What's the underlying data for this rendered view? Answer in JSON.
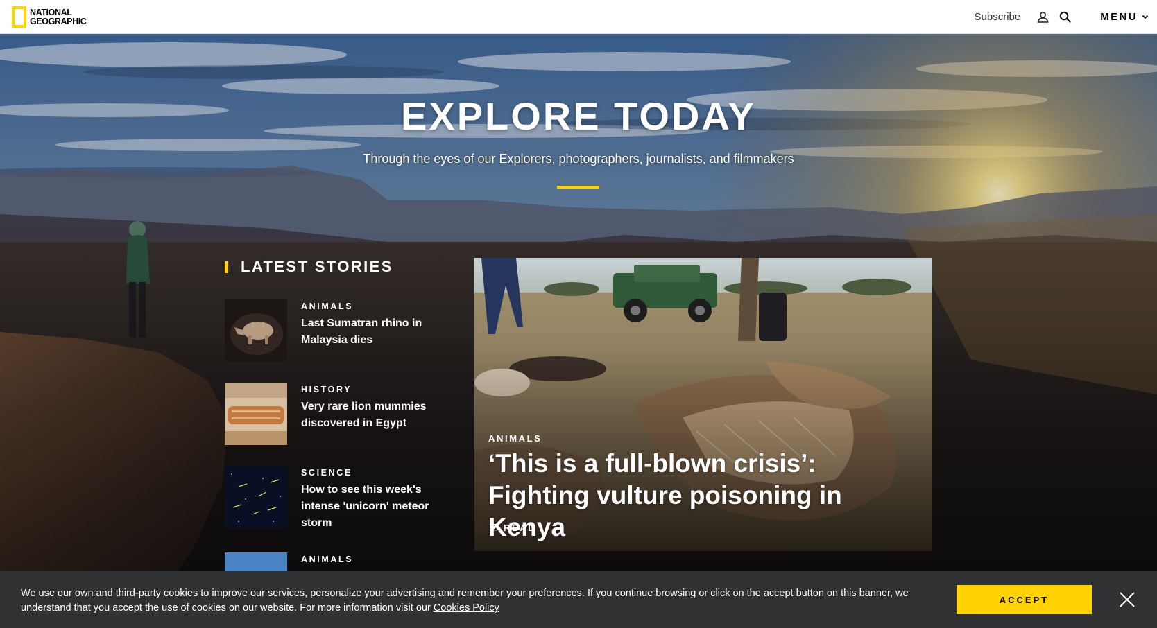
{
  "header": {
    "logo_line1": "NATIONAL",
    "logo_line2": "GEOGRAPHIC",
    "subscribe_label": "Subscribe",
    "user_icon": "user-icon",
    "search_icon": "search-icon",
    "menu_label": "MENU",
    "menu_icon": "chevron-down-icon"
  },
  "hero": {
    "title": "EXPLORE TODAY",
    "subtitle": "Through the eyes of our Explorers, photographers, journalists, and filmmakers",
    "accent_color": "#ffd200"
  },
  "latest": {
    "heading": "LATEST STORIES",
    "stories": [
      {
        "kicker": "ANIMALS",
        "title": "Last Sumatran rhino in Malaysia dies"
      },
      {
        "kicker": "HISTORY",
        "title": "Very rare lion mummies discovered in Egypt"
      },
      {
        "kicker": "SCIENCE",
        "title": "How to see this week's intense 'unicorn' meteor storm"
      },
      {
        "kicker": "ANIMALS",
        "title": ""
      }
    ]
  },
  "feature": {
    "kicker": "ANIMALS",
    "title": "‘This is a full-blown crisis’: Fighting vulture poisoning in Kenya",
    "read_label": "READ",
    "read_icon": "list-icon"
  },
  "cookie": {
    "text": "We use our own and third-party cookies to improve our services, personalize your advertising and remember your preferences. If you continue browsing or click on the accept button on this banner, we understand that you accept the use of cookies on our website. For more information visit our ",
    "link_label": "Cookies Policy",
    "accept_label": "ACCEPT",
    "close_icon": "close-icon"
  }
}
